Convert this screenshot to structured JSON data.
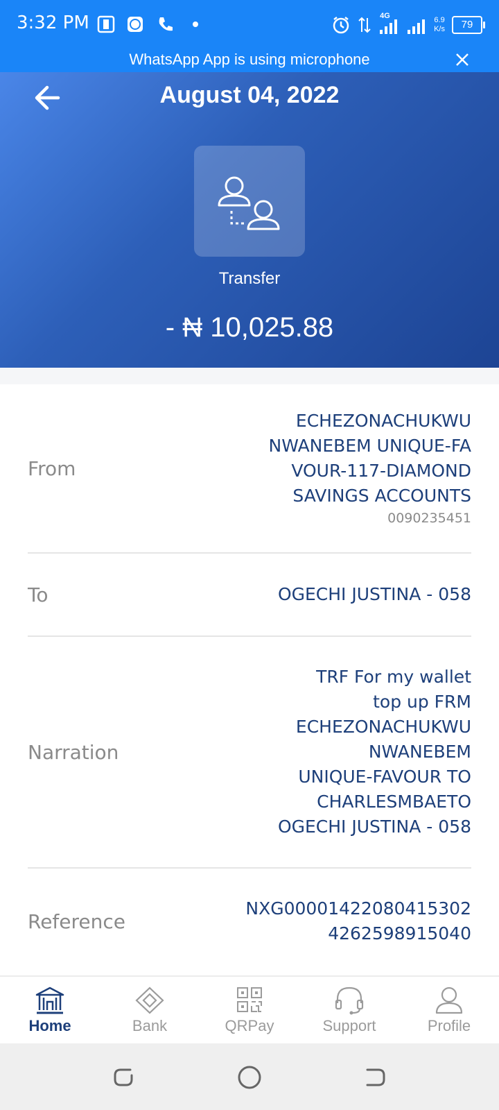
{
  "status_bar": {
    "time": "3:32 PM",
    "network": "4G",
    "speed_value": "6.9",
    "speed_unit": "K/s",
    "battery": "79"
  },
  "banner": {
    "text": "WhatsApp App is using microphone"
  },
  "header": {
    "title": "August 04, 2022",
    "transaction_type": "Transfer",
    "amount": "- ₦ 10,025.88"
  },
  "details": {
    "from_label": "From",
    "from_value_lines": [
      "ECHEZONACHUKWU",
      "NWANEBEM UNIQUE-FA",
      "VOUR-117-DIAMOND",
      "SAVINGS ACCOUNTS"
    ],
    "from_account": "0090235451",
    "to_label": "To",
    "to_value": "OGECHI JUSTINA - 058",
    "narration_label": "Narration",
    "narration_lines": [
      "TRF For my wallet",
      "top up FRM",
      "ECHEZONACHUKWU",
      "NWANEBEM",
      "UNIQUE-FAVOUR TO",
      "CHARLESMBAETO",
      "OGECHI JUSTINA - 058"
    ],
    "reference_label": "Reference",
    "reference_lines": [
      "NXG00001422080415302",
      "4262598915040"
    ]
  },
  "nav": {
    "home": "Home",
    "bank": "Bank",
    "qrpay": "QRPay",
    "support": "Support",
    "profile": "Profile"
  },
  "colors": {
    "status_bar": "#1a85f8",
    "header_start": "#4a86e8",
    "header_end": "#1d4494",
    "value_text": "#1d3f7a",
    "label_text": "#8a8a8a"
  }
}
